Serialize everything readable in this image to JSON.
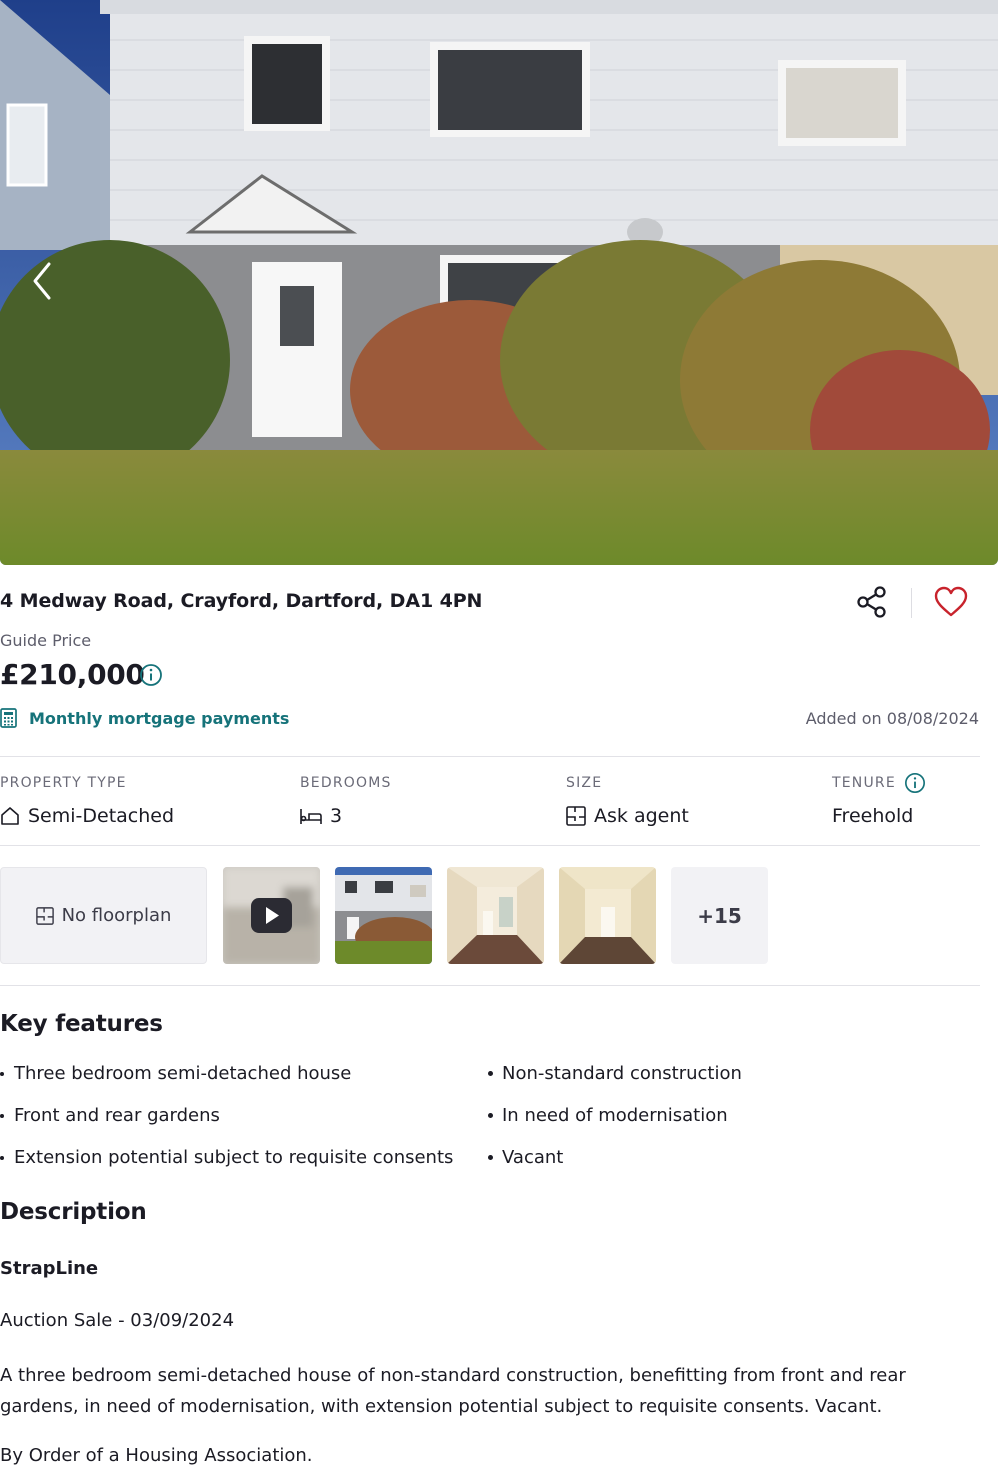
{
  "listing": {
    "address": "4 Medway Road, Crayford, Dartford, DA1 4PN",
    "guide_label": "Guide Price",
    "price": "£210,000",
    "mortgage_link": "Monthly mortgage payments",
    "added_on": "Added on 08/08/2024"
  },
  "facts": {
    "property_type": {
      "label": "PROPERTY TYPE",
      "value": "Semi-Detached",
      "icon": "house-icon"
    },
    "bedrooms": {
      "label": "BEDROOMS",
      "value": "3",
      "icon": "bed-icon"
    },
    "size": {
      "label": "SIZE",
      "value": "Ask agent",
      "icon": "floorplan-icon"
    },
    "tenure": {
      "label": "TENURE",
      "value": "Freehold",
      "icon": "info-icon"
    }
  },
  "media": {
    "floorplan_label": "No floorplan",
    "more_count": "+15"
  },
  "key_features": {
    "title": "Key features",
    "left": [
      "Three bedroom semi-detached house",
      "Front and rear gardens",
      "Extension potential subject to requisite consents"
    ],
    "right": [
      "Non-standard construction",
      "In need of modernisation",
      "Vacant"
    ]
  },
  "description": {
    "title": "Description",
    "strapline": "StrapLine",
    "auction": "Auction Sale - 03/09/2024",
    "paragraph": "A three bedroom semi-detached house of non-standard construction, benefitting from front and rear gardens, in need of modernisation, with extension potential subject to requisite consents. Vacant.",
    "order": "By Order of a Housing Association."
  },
  "colors": {
    "accent_teal": "#16737a",
    "heart_red": "#c8232c",
    "text_dark": "#1b1b24",
    "text_muted": "#5d5d6b"
  }
}
